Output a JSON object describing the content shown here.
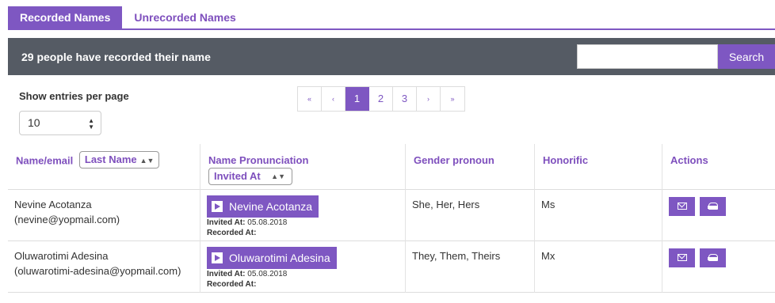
{
  "tabs": [
    {
      "label": "Recorded Names",
      "active": true
    },
    {
      "label": "Unrecorded Names",
      "active": false
    }
  ],
  "header": {
    "title": "29 people have recorded their name",
    "search_value": "",
    "search_button": "Search"
  },
  "entries": {
    "label": "Show entries per page",
    "value": "10"
  },
  "pagination": {
    "first": "«",
    "prev": "‹",
    "pages": [
      "1",
      "2",
      "3"
    ],
    "current": "1",
    "next": "›",
    "last": "»"
  },
  "table": {
    "headers": {
      "name": "Name/email",
      "name_sort": "Last Name",
      "pronunciation": "Name Pronunciation",
      "pronunciation_sort": "Invited At",
      "gender": "Gender pronoun",
      "honorific": "Honorific",
      "actions": "Actions"
    },
    "invited_label": "Invited At:",
    "recorded_label": "Recorded At:",
    "rows": [
      {
        "name": "Nevine Acotanza",
        "email": "(nevine@yopmail.com)",
        "play_label": "Nevine Acotanza",
        "invited_at": "05.08.2018",
        "recorded_at": "",
        "gender": "She, Her, Hers",
        "honorific": "Ms"
      },
      {
        "name": "Oluwarotimi Adesina",
        "email": "(oluwarotimi-adesina@yopmail.com)",
        "play_label": "Oluwarotimi Adesina",
        "invited_at": "05.08.2018",
        "recorded_at": "",
        "gender": "They, Them, Theirs",
        "honorific": "Mx"
      }
    ]
  },
  "icons": {
    "play": "play-icon",
    "mail": "mail-icon",
    "inbox": "inbox-icon",
    "sort": "sort-arrows-icon"
  },
  "colors": {
    "accent": "#7e57c2",
    "header_bg": "#555b64"
  }
}
